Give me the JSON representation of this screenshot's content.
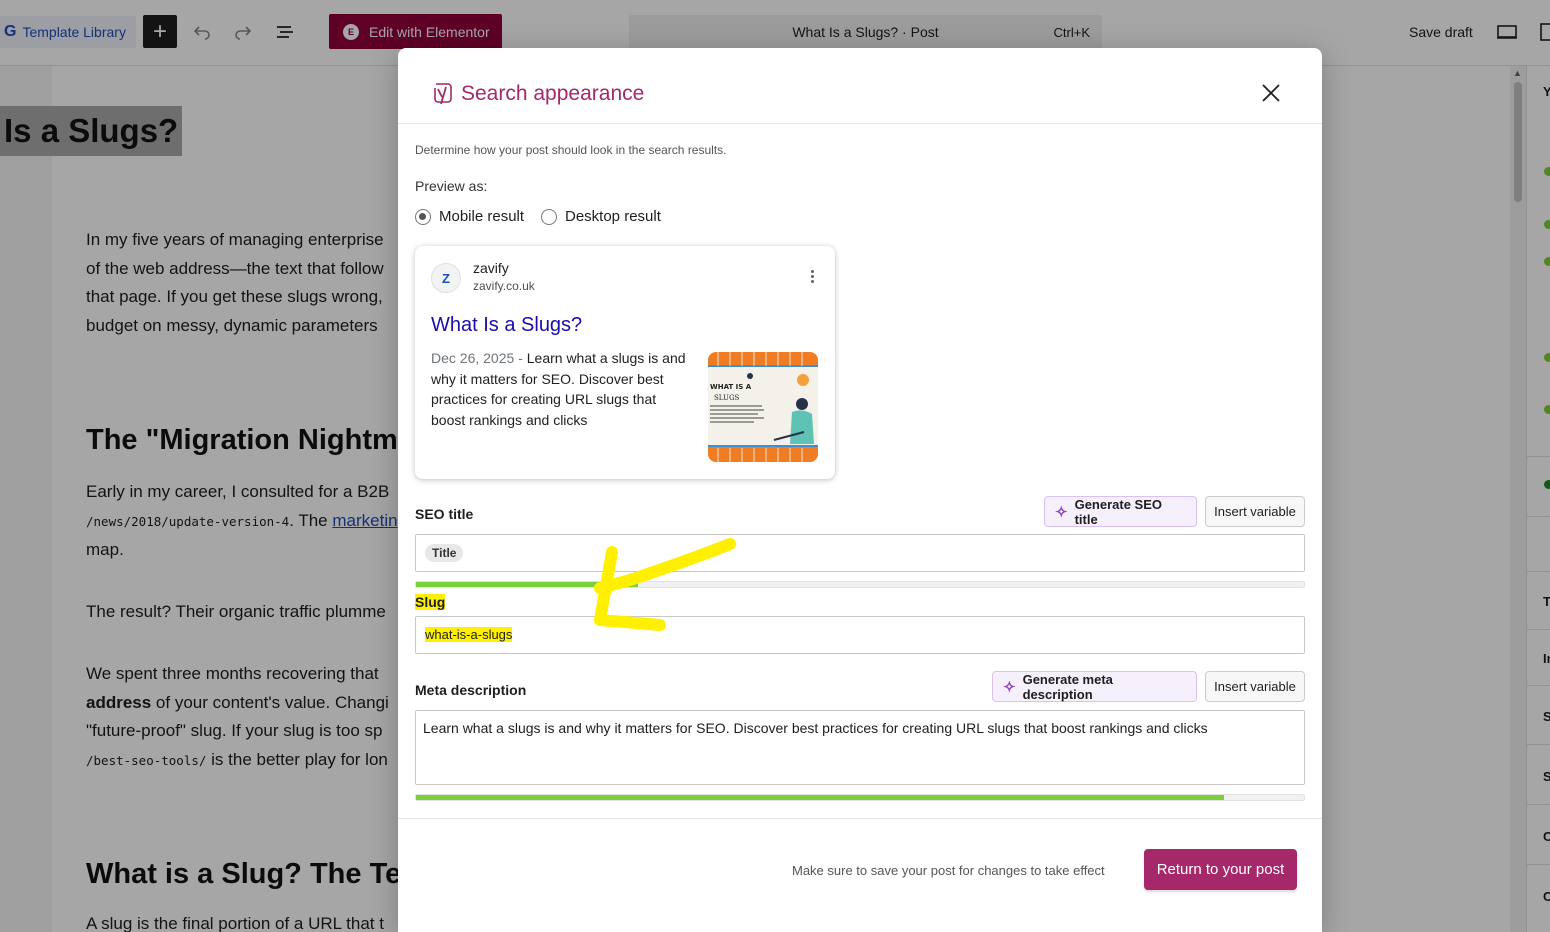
{
  "topbar": {
    "template_library": "Template Library",
    "template_library_g": "G",
    "add_icon": "plus-icon",
    "undo_icon": "undo-icon",
    "redo_icon": "redo-icon",
    "outline_icon": "list-view-icon",
    "elementor_label": "Edit with Elementor",
    "elementor_mark": "E",
    "command_title": "What Is a Slugs? · Post",
    "command_shortcut": "Ctrl+K",
    "save_draft": "Save draft",
    "preview_icon": "desktop-icon",
    "settings_icon": "sidebar-icon"
  },
  "post": {
    "title": "Is a Slugs?",
    "intro_lines": [
      "In my five years of managing enterprise",
      "of the web address—the text that follow",
      "that page. If you get these slugs wrong,",
      "budget on messy, dynamic parameters"
    ],
    "h2_migration": "The \"Migration Nightm",
    "career_line1": "Early in my career, I consulted for a B2B",
    "career_code": "/news/2018/update-version-4",
    "career_mid": ". The ",
    "career_link": "marketin",
    "career_line3": "map.",
    "result_line": "The result? Their organic traffic plumme",
    "spent_line1": "We spent three months recovering that",
    "spent_bold": "address",
    "spent_line2_rest": " of your content's value. Changi",
    "spent_line3": "\"future-proof\" slug. If your slug is too sp",
    "spent_code": "/best-seo-tools/",
    "spent_line4_rest": " is the better play for lon",
    "h2_what": "What is a Slug? The Tec",
    "last_line": "A slug is the final portion of a URL that t"
  },
  "sidebar": {
    "letters": [
      "Y",
      "T",
      "In",
      "S",
      "S",
      "C",
      "C"
    ]
  },
  "modal": {
    "title": "Search appearance",
    "logo_icon": "yoast-logo-icon",
    "close_icon": "close-icon",
    "intro": "Determine how your post should look in the search results.",
    "preview_as": "Preview as:",
    "mobile_label": "Mobile result",
    "desktop_label": "Desktop result",
    "selected_preview": "Mobile result",
    "serp": {
      "favicon_letter": "Z",
      "site_name": "zavify",
      "site_url": "zavify.co.uk",
      "title": "What Is a Slugs?",
      "date": "Dec 26, 2025",
      "separator": " - ",
      "description": "Learn what a slugs is and why it matters for SEO. Discover best practices for creating URL slugs that boost rankings and clicks",
      "thumb_text_1": "WHAT IS A",
      "thumb_text_2": "SLUGS"
    },
    "seo_title": {
      "label": "SEO title",
      "generate": "Generate SEO title",
      "insert_variable": "Insert variable",
      "value_pill": "Title",
      "progress": 0.25
    },
    "slug": {
      "label": "Slug",
      "value": "what-is-a-slugs"
    },
    "meta": {
      "label": "Meta description",
      "generate": "Generate meta description",
      "insert_variable": "Insert variable",
      "value": "Learn what a slugs is and why it matters for SEO. Discover best practices for creating URL slugs that boost rankings and clicks",
      "progress": 0.91
    },
    "footer_note": "Make sure to save your post for changes to take effect",
    "return_button": "Return to your post"
  },
  "colors": {
    "yoast_primary": "#a4286a",
    "progress_green": "#7ad03a",
    "highlight_yellow": "#ffef00",
    "serp_link": "#1a0dab",
    "elementor": "#92003b"
  }
}
